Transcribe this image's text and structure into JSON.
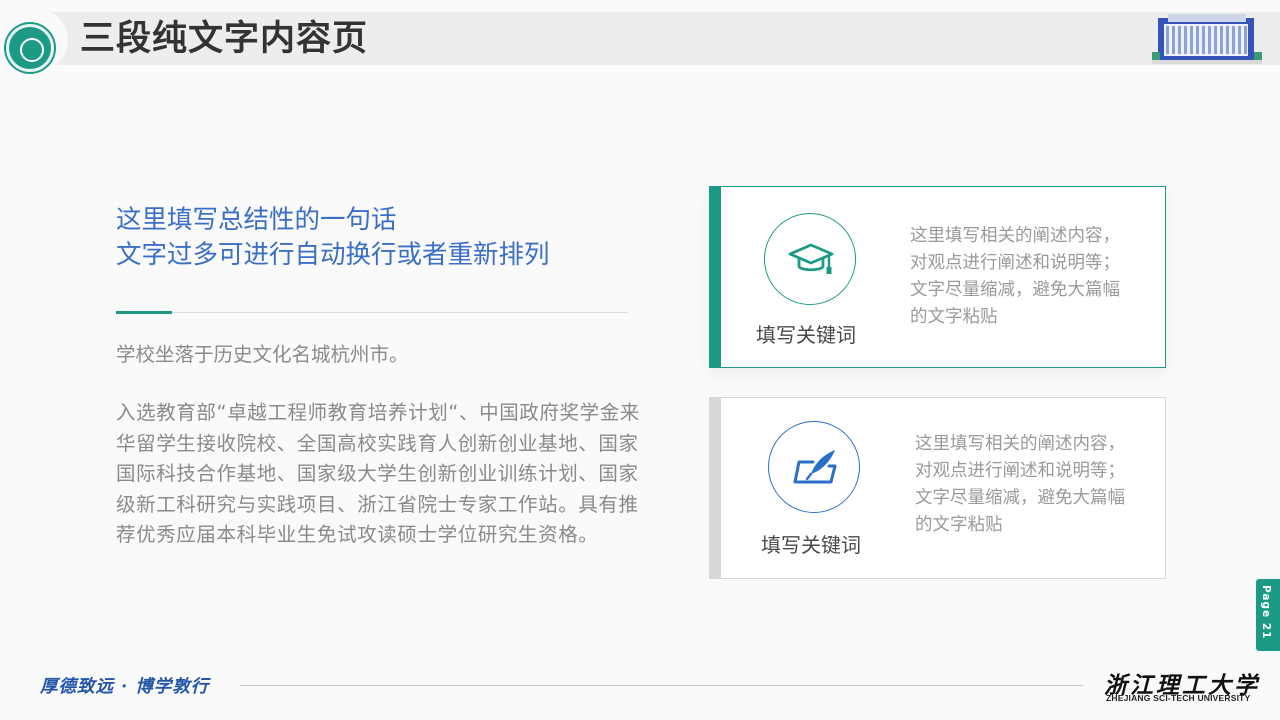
{
  "header": {
    "title": "三段纯文字内容页"
  },
  "summary": {
    "line1": "这里填写总结性的一句话",
    "line2": "文字过多可进行自动换行或者重新排列"
  },
  "body": {
    "paragraph1": "学校坐落于历史文化名城杭州市。",
    "paragraph2": "入选教育部“卓越工程师教育培养计划“、中国政府奖学金来华留学生接收院校、全国高校实践育人创新创业基地、国家国际科技合作基地、国家级大学生创新创业训练计划、国家级新工科研究与实践项目、浙江省院士专家工作站。具有推荐优秀应届本科毕业生免试攻读硕士学位研究生资格。"
  },
  "cards": [
    {
      "keyword": "填写关键词",
      "description": "这里填写相关的阐述内容，对观点进行阐述和说明等；文字尽量缩减，避免大篇幅的文字粘贴",
      "icon": "graduation-cap-icon",
      "accent": "#1c9a86"
    },
    {
      "keyword": "填写关键词",
      "description": "这里填写相关的阐述内容，对观点进行阐述和说明等；文字尽量缩减，避免大篇幅的文字粘贴",
      "icon": "quill-pen-icon",
      "accent": "#2a6fc7"
    }
  ],
  "page_tab": "Page 21",
  "footer": {
    "motto": "厚德致远 · 博学敦行",
    "university_cn": "浙江理工大学",
    "university_en": "ZHEJIANG SCI-TECH UNIVERSITY"
  },
  "colors": {
    "teal": "#1c9a86",
    "blue": "#3b6fc6",
    "motto_blue": "#2356a8"
  }
}
